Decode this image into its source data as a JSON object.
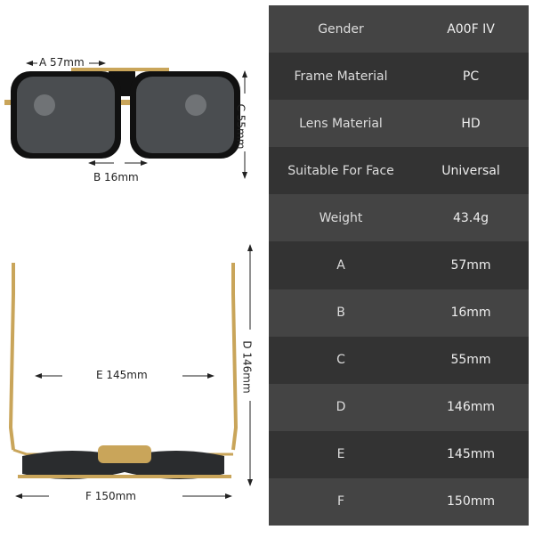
{
  "dimensions": {
    "a": "A 57mm",
    "b": "B 16mm",
    "c": "C 55mm",
    "d": "D 146mm",
    "e": "E 145mm",
    "f": "F 150mm"
  },
  "colors": {
    "frame": "#111111",
    "gold": "#c9a55a",
    "lens": "#4a4d50"
  },
  "specs": [
    {
      "label": "Gender",
      "value": "A00F IV"
    },
    {
      "label": "Frame Material",
      "value": "PC"
    },
    {
      "label": "Lens Material",
      "value": "HD"
    },
    {
      "label": "Suitable For Face",
      "value": "Universal"
    },
    {
      "label": "Weight",
      "value": "43.4g"
    },
    {
      "label": "A",
      "value": "57mm"
    },
    {
      "label": "B",
      "value": "16mm"
    },
    {
      "label": "C",
      "value": "55mm"
    },
    {
      "label": "D",
      "value": "146mm"
    },
    {
      "label": "E",
      "value": "145mm"
    },
    {
      "label": "F",
      "value": "150mm"
    }
  ]
}
